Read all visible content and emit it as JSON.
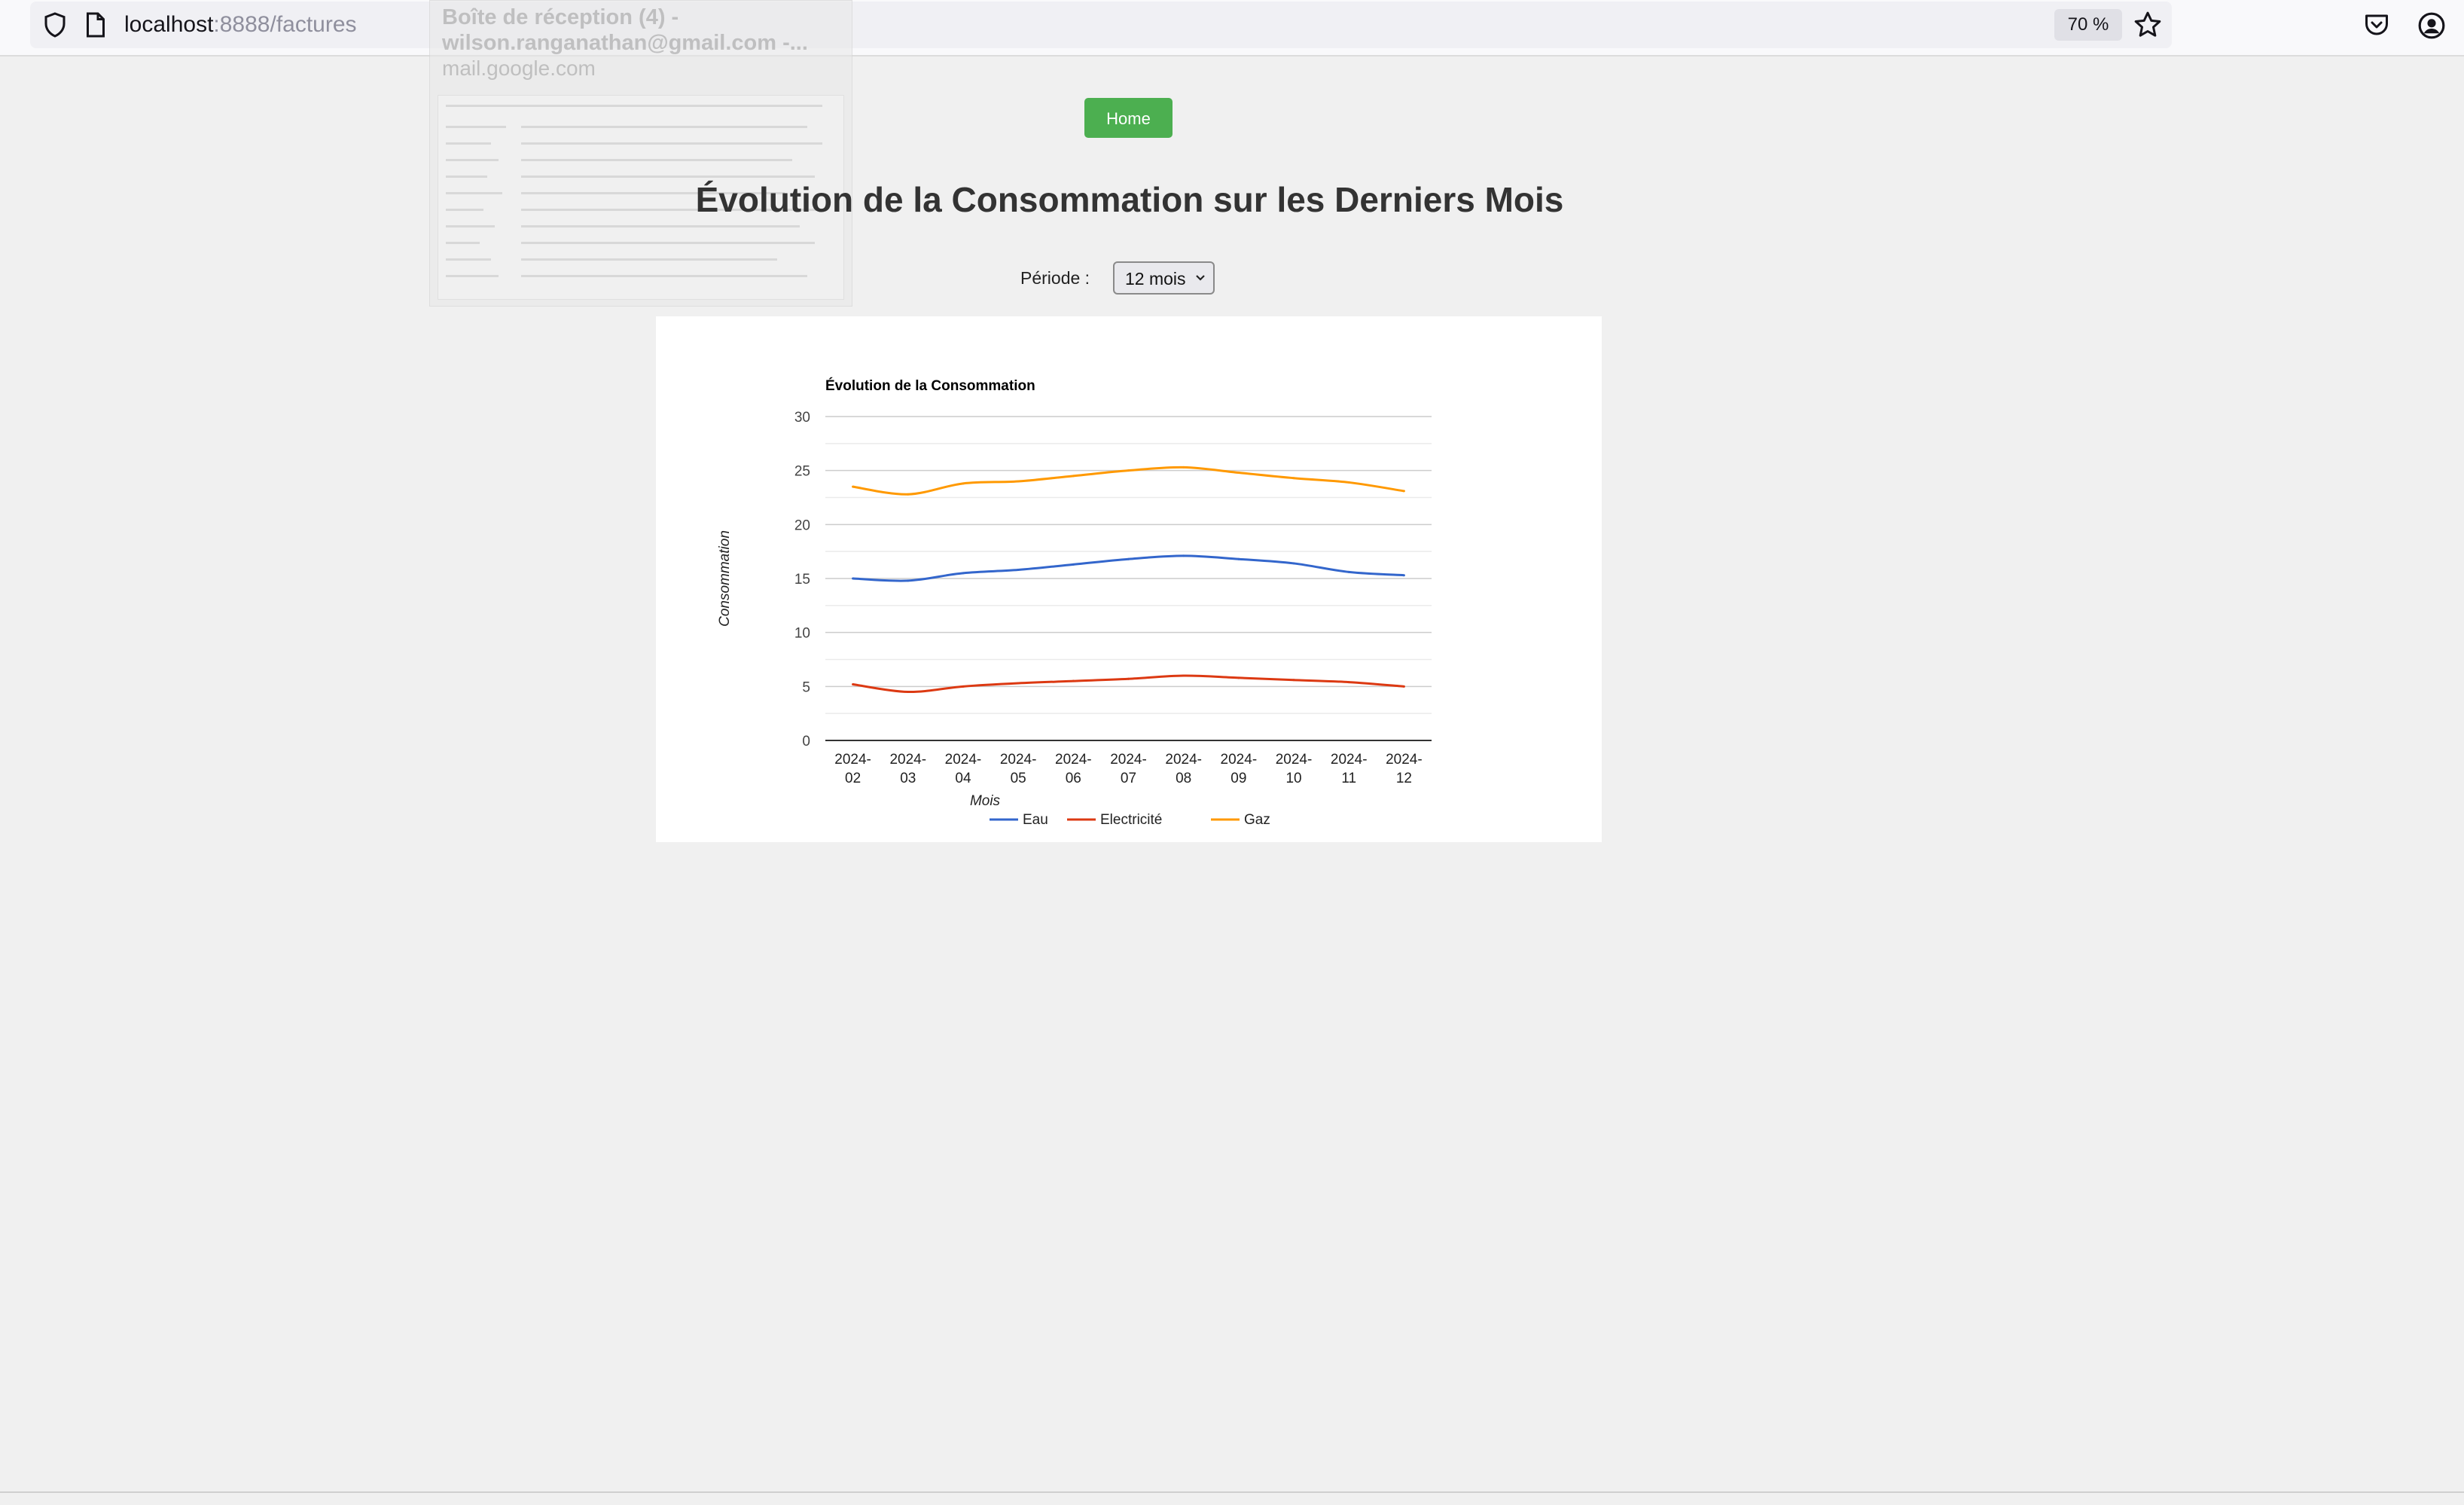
{
  "browser": {
    "url_host": "localhost",
    "url_path": ":8888/factures",
    "zoom": "70 %"
  },
  "ghost_tab": {
    "title_line1": "Boîte de réception (4) -",
    "title_line2": "wilson.ranganathan@gmail.com -...",
    "domain": "mail.google.com"
  },
  "page": {
    "home_label": "Home",
    "title": "Évolution de la Consommation sur les Derniers Mois",
    "period_label": "Période :",
    "period_value": "12 mois"
  },
  "colors": {
    "accent": "#4caf50",
    "eau": "#3366cc",
    "electricite": "#dc3912",
    "gaz": "#ff9900"
  },
  "chart_data": {
    "type": "line",
    "title": "Évolution de la Consommation",
    "xlabel": "Mois",
    "ylabel": "Consommation",
    "ylim": [
      0,
      30
    ],
    "yticks": [
      0,
      5,
      10,
      15,
      20,
      25,
      30
    ],
    "grid": true,
    "legend_position": "bottom",
    "categories": [
      [
        "2024-",
        "02"
      ],
      [
        "2024-",
        "03"
      ],
      [
        "2024-",
        "04"
      ],
      [
        "2024-",
        "05"
      ],
      [
        "2024-",
        "06"
      ],
      [
        "2024-",
        "07"
      ],
      [
        "2024-",
        "08"
      ],
      [
        "2024-",
        "09"
      ],
      [
        "2024-",
        "10"
      ],
      [
        "2024-",
        "11"
      ],
      [
        "2024-",
        "12"
      ]
    ],
    "series": [
      {
        "name": "Eau",
        "color": "#3366cc",
        "values": [
          15.0,
          14.8,
          15.5,
          15.8,
          16.3,
          16.8,
          17.1,
          16.8,
          16.4,
          15.6,
          15.3
        ]
      },
      {
        "name": "Electricité",
        "color": "#dc3912",
        "values": [
          5.2,
          4.5,
          5.0,
          5.3,
          5.5,
          5.7,
          6.0,
          5.8,
          5.6,
          5.4,
          5.0
        ]
      },
      {
        "name": "Gaz",
        "color": "#ff9900",
        "values": [
          23.5,
          22.8,
          23.8,
          24.0,
          24.5,
          25.0,
          25.3,
          24.8,
          24.3,
          23.9,
          23.1
        ]
      }
    ]
  }
}
